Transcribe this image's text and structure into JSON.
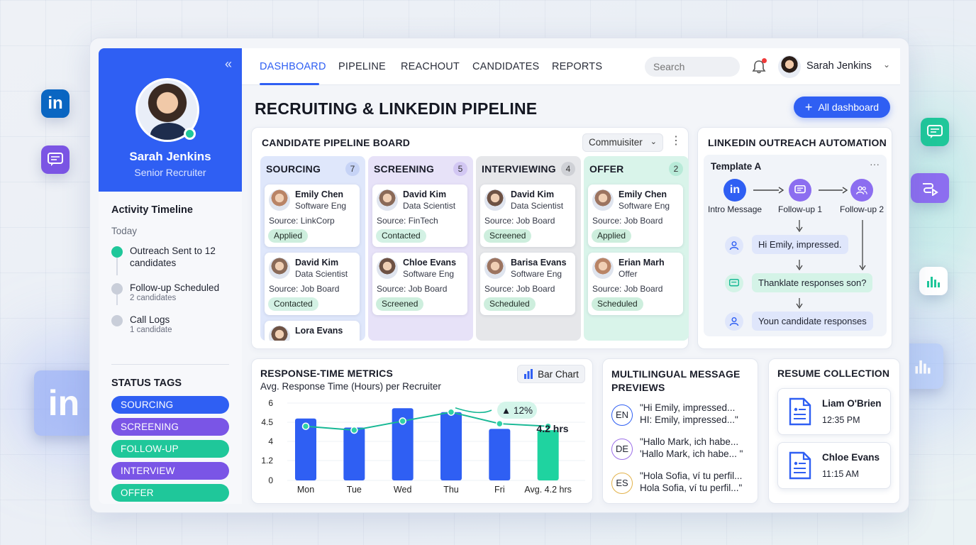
{
  "nav": {
    "tabs": [
      {
        "label": "DASHBOARD"
      },
      {
        "label": "PIPELINE"
      },
      {
        "label": "REACHOUT"
      },
      {
        "label": "CANDIDATES"
      },
      {
        "label": "REPORTS"
      }
    ],
    "search_placeholder": "Search",
    "user_name": "Sarah Jenkins"
  },
  "sidebar": {
    "profile_name": "Sarah Jenkins",
    "profile_role": "Senior Recruiter",
    "timeline_title": "Activity Timeline",
    "timeline_day": "Today",
    "timeline": [
      {
        "main": "Outreach Sent to 12 candidates",
        "sub": "",
        "color": "#1fc79a"
      },
      {
        "main": "Follow-up Scheduled",
        "sub": "2 candidates",
        "color": "#c9ced9"
      },
      {
        "main": "Call Logs",
        "sub": "1 candidate",
        "color": "#c9ced9"
      }
    ],
    "status_title": "STATUS TAGS",
    "status_tags": [
      {
        "label": "SOURCING",
        "color": "#2f5ff3"
      },
      {
        "label": "SCREENING",
        "color": "#7a55e6"
      },
      {
        "label": "FOLLOW-UP",
        "color": "#1fc79a"
      },
      {
        "label": "INTERVIEW",
        "color": "#7a55e6"
      },
      {
        "label": "OFFER",
        "color": "#1fc79a"
      }
    ]
  },
  "main": {
    "title": "RECRUITING & LINKEDIN PIPELINE",
    "all_dashboard_label": "All dashboard"
  },
  "board": {
    "title": "CANDIDATE PIPELINE BOARD",
    "select_value": "Commuisiter",
    "columns": [
      {
        "name": "SOURCING",
        "count": "7",
        "bg": "#dfe7fb",
        "countbg": "#c6d3f6",
        "cards": [
          {
            "name": "Emily Chen",
            "role": "Software Eng",
            "source": "Source: LinkCorp",
            "badge": "Applied"
          },
          {
            "name": "David Kim",
            "role": "Data Scientist",
            "source": "Source: Job Board",
            "badge": "Contacted"
          },
          {
            "name": "Lora Evans",
            "role": "",
            "source": "",
            "badge": ""
          }
        ]
      },
      {
        "name": "SCREENING",
        "count": "5",
        "bg": "#e7e2f8",
        "countbg": "#d2c7f3",
        "cards": [
          {
            "name": "David Kim",
            "role": "Data Scientist",
            "source": "Source: FinTech",
            "badge": "Contacted"
          },
          {
            "name": "Chloe Evans",
            "role": "Software Eng",
            "source": "Source: Job Board",
            "badge": "Screened"
          }
        ]
      },
      {
        "name": "INTERVIEWING",
        "count": "4",
        "bg": "#e6e7ea",
        "countbg": "#cfd1d6",
        "cards": [
          {
            "name": "David Kim",
            "role": "Data Scientist",
            "source": "Source: Job Board",
            "badge": "Screened"
          },
          {
            "name": "Barisa Evans",
            "role": "Software Eng",
            "source": "Source: Job Board",
            "badge": "Scheduled"
          }
        ]
      },
      {
        "name": "OFFER",
        "count": "2",
        "bg": "#d9f4ea",
        "countbg": "#b8ead8",
        "cards": [
          {
            "name": "Emily Chen",
            "role": "Software Eng",
            "source": "Source: Job Board",
            "badge": "Applied"
          },
          {
            "name": "Erian Marh",
            "role": "Offer",
            "source": "Source: Job Board",
            "badge": "Scheduled"
          }
        ]
      }
    ]
  },
  "outreach": {
    "title": "LINKEDIN OUTREACH AUTOMATION",
    "template_title": "Template A",
    "steps": [
      "Intro Message",
      "Follow-up 1",
      "Follow-up 2"
    ],
    "bubbles": [
      "Hi Emily, impressed.",
      "Thanklate responses son?",
      "Youn candidate responses"
    ]
  },
  "metrics": {
    "title": "RESPONSE-TIME METRICS",
    "subtitle": "Avg. Response Time (Hours) per Recruiter",
    "chart_btn_label": "Bar Chart"
  },
  "chart_data": {
    "type": "bar",
    "title": "Avg. Response Time (Hours) per Recruiter",
    "categories": [
      "Mon",
      "Tue",
      "Wed",
      "Thu",
      "Fri",
      "Avg. 4.2 hrs"
    ],
    "series": [
      {
        "values": [
          4.8,
          4.1,
          5.6,
          5.3,
          4.0,
          3.9
        ]
      },
      {
        "values": [
          4.2,
          3.9,
          4.6,
          5.3,
          4.4,
          4.2
        ]
      }
    ],
    "bar_colors": [
      "#2f5ff3",
      "#2f5ff3",
      "#2f5ff3",
      "#2f5ff3",
      "#2f5ff3",
      "#1fd3a0"
    ],
    "line_color": "#17b895",
    "yticks": [
      "6",
      "4.5",
      "4",
      "1.2",
      "0"
    ],
    "ylim": [
      0,
      6
    ],
    "annotations": [
      "12%",
      "4.2 hrs"
    ],
    "legend": "none"
  },
  "multilingual": {
    "title_line1": "MULTILINGUAL MESSAGE",
    "title_line2": "PREVIEWS",
    "items": [
      {
        "lang": "EN",
        "line1": "\"Hi Emily, impressed...",
        "line2": "HI: Emily, impressed...\"",
        "border": "#2f5ff3"
      },
      {
        "lang": "DE",
        "line1": "\"Hallo Mark, ich habe...",
        "line2": "'Hallo Mark, ich habe... \"",
        "border": "#9b6ee8"
      },
      {
        "lang": "ES",
        "line1": "\"Hola Sofia, ví tu perfil...",
        "line2": "Hola Sofia, ví tu perfil...\"",
        "border": "#e2b24a"
      }
    ]
  },
  "resume": {
    "title": "RESUME COLLECTION",
    "items": [
      {
        "name": "Liam O'Brien",
        "time": "12:35 PM"
      },
      {
        "name": "Chloe Evans",
        "time": "11:15 AM"
      }
    ]
  },
  "colors": {
    "accent": "#2f5ff3",
    "success": "#1fc79a",
    "violet": "#7a55e6"
  }
}
